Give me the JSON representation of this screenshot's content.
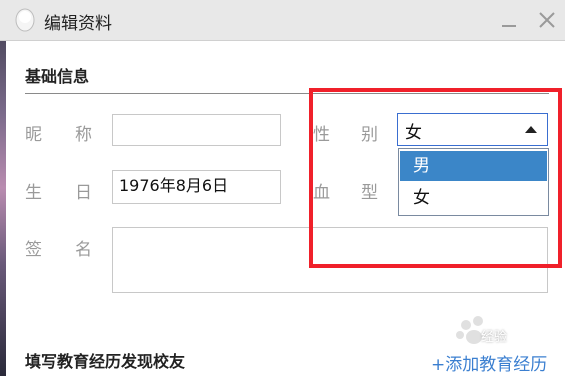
{
  "window": {
    "title": "编辑资料",
    "minimize_icon": "minimize-icon",
    "close_icon": "close-icon"
  },
  "basic_info": {
    "section_title": "基础信息",
    "nickname": {
      "label_1": "昵",
      "label_2": "称",
      "value": ""
    },
    "gender": {
      "label_1": "性",
      "label_2": "别",
      "selected": "女",
      "options": [
        "男",
        "女"
      ],
      "highlighted_option": "男"
    },
    "birthday": {
      "label_1": "生",
      "label_2": "日",
      "value": "1976年8月6日"
    },
    "blood_type": {
      "label_1": "血",
      "label_2": "型"
    },
    "signature": {
      "label_1": "签",
      "label_2": "名",
      "value": ""
    }
  },
  "education": {
    "section_title": "填写教育经历发现校友",
    "add_link": "+添加教育经历"
  },
  "watermark": {
    "text": "经验"
  },
  "colors": {
    "titlebar_bg": "#e8e8e8",
    "highlight_red": "#f0202a",
    "selected_option_bg": "#3b86c8",
    "link_blue": "#3b7fd0",
    "label_gray": "#9a9a9a"
  }
}
